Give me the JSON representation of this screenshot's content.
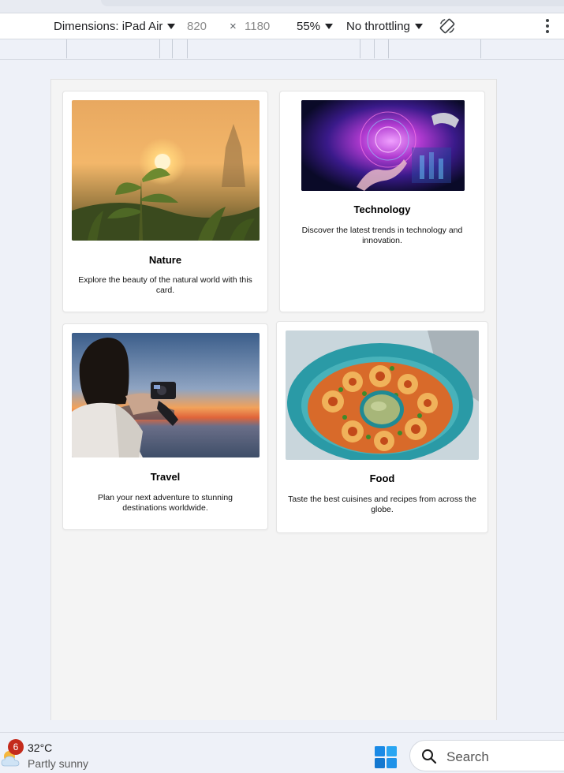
{
  "device_toolbar": {
    "dimensions_label": "Dimensions: iPad Air",
    "width": "820",
    "times": "×",
    "height": "1180",
    "zoom": "55%",
    "throttling": "No throttling"
  },
  "cards": [
    {
      "title": "Nature",
      "description": "Explore the beauty of the natural world with this card."
    },
    {
      "title": "Technology",
      "description": "Discover the latest trends in technology and innovation."
    },
    {
      "title": "Travel",
      "description": "Plan your next adventure to stunning destinations worldwide."
    },
    {
      "title": "Food",
      "description": "Taste the best cuisines and recipes from across the globe."
    }
  ],
  "taskbar": {
    "weather_badge": "6",
    "temperature": "32°C",
    "condition": "Partly sunny",
    "search_label": "Search"
  }
}
